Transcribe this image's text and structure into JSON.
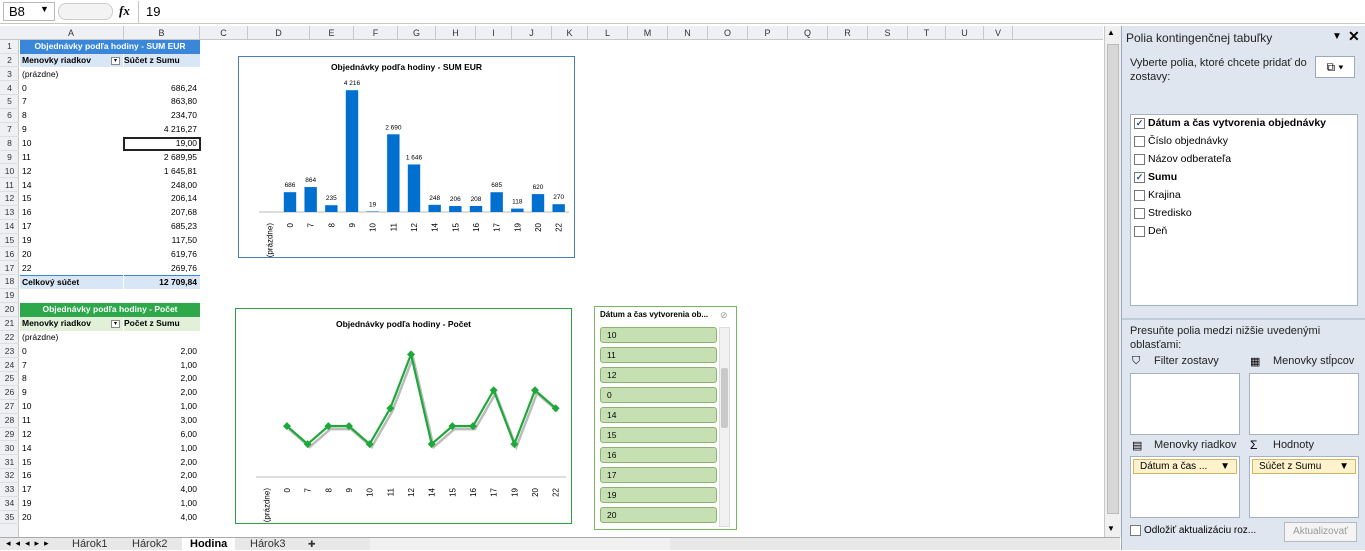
{
  "formula_bar": {
    "name_box": "B8",
    "fx": "fx",
    "value": "19"
  },
  "columns": [
    "A",
    "B",
    "C",
    "D",
    "E",
    "F",
    "G",
    "H",
    "I",
    "J",
    "K",
    "L",
    "M",
    "N",
    "O",
    "P",
    "Q",
    "R",
    "S",
    "T",
    "U",
    "V"
  ],
  "rows": [
    "1",
    "2",
    "3",
    "4",
    "5",
    "6",
    "7",
    "8",
    "9",
    "10",
    "11",
    "12",
    "13",
    "14",
    "15",
    "16",
    "17",
    "18",
    "19",
    "20",
    "21",
    "22",
    "23",
    "24",
    "25",
    "26",
    "27",
    "28",
    "29",
    "30",
    "31",
    "32",
    "33",
    "34",
    "35"
  ],
  "pivot1": {
    "title": "Objednávky podľa hodiny - SUM EUR",
    "col_a": "Menovky riadkov",
    "col_b": "Súčet z Sumu",
    "rows": [
      [
        "(prázdne)",
        ""
      ],
      [
        "0",
        "686,24"
      ],
      [
        "7",
        "863,80"
      ],
      [
        "8",
        "234,70"
      ],
      [
        "9",
        "4 216,27"
      ],
      [
        "10",
        "19,00"
      ],
      [
        "11",
        "2 689,95"
      ],
      [
        "12",
        "1 645,81"
      ],
      [
        "14",
        "248,00"
      ],
      [
        "15",
        "206,14"
      ],
      [
        "16",
        "207,68"
      ],
      [
        "17",
        "685,23"
      ],
      [
        "19",
        "117,50"
      ],
      [
        "20",
        "619,76"
      ],
      [
        "22",
        "269,76"
      ]
    ],
    "total_label": "Celkový súčet",
    "total_value": "12 709,84"
  },
  "pivot2": {
    "title": "Objednávky podľa hodiny - Počet",
    "col_a": "Menovky riadkov",
    "col_b": "Počet z Sumu",
    "rows": [
      [
        "(prázdne)",
        ""
      ],
      [
        "0",
        "2,00"
      ],
      [
        "7",
        "1,00"
      ],
      [
        "8",
        "2,00"
      ],
      [
        "9",
        "2,00"
      ],
      [
        "10",
        "1,00"
      ],
      [
        "11",
        "3,00"
      ],
      [
        "12",
        "6,00"
      ],
      [
        "14",
        "1,00"
      ],
      [
        "15",
        "2,00"
      ],
      [
        "16",
        "2,00"
      ],
      [
        "17",
        "4,00"
      ],
      [
        "19",
        "1,00"
      ],
      [
        "20",
        "4,00"
      ]
    ]
  },
  "chart_data": [
    {
      "type": "bar",
      "title": "Objednávky podľa hodiny - SUM EUR",
      "categories": [
        "(prázdne)",
        "0",
        "7",
        "8",
        "9",
        "10",
        "11",
        "12",
        "14",
        "15",
        "16",
        "17",
        "19",
        "20",
        "22"
      ],
      "values": [
        0,
        686,
        864,
        235,
        4216,
        19,
        2690,
        1646,
        248,
        206,
        208,
        685,
        118,
        620,
        270
      ],
      "data_labels": [
        "",
        "686",
        "864",
        "235",
        "4 216",
        "19",
        "2 690",
        "1 646",
        "248",
        "206",
        "208",
        "685",
        "118",
        "620",
        "270"
      ],
      "color": "#0070d0"
    },
    {
      "type": "line",
      "title": "Objednávky podľa hodiny - Počet",
      "categories": [
        "(prázdne)",
        "0",
        "7",
        "8",
        "9",
        "10",
        "11",
        "12",
        "14",
        "15",
        "16",
        "17",
        "19",
        "20",
        "22"
      ],
      "values": [
        null,
        2,
        1,
        2,
        2,
        1,
        3,
        6,
        1,
        2,
        2,
        4,
        1,
        4,
        3
      ],
      "color": "#1fa83a"
    }
  ],
  "slicer": {
    "title": "Dátum a čas vytvorenia ob...",
    "items": [
      "10",
      "11",
      "12",
      "0",
      "14",
      "15",
      "16",
      "17",
      "19",
      "20"
    ]
  },
  "sheet_tabs": [
    "Hárok1",
    "Hárok2",
    "Hodina",
    "Hárok3"
  ],
  "active_tab": "Hodina",
  "panel": {
    "title": "Polia kontingenčnej tabuľky",
    "choose_text": "Vyberte polia, ktoré chcete pridať do zostavy:",
    "fields": [
      {
        "label": "Dátum a čas vytvorenia objednávky",
        "checked": true
      },
      {
        "label": "Číslo objednávky",
        "checked": false
      },
      {
        "label": "Názov odberateľa",
        "checked": false
      },
      {
        "label": "Sumu",
        "checked": true
      },
      {
        "label": "Krajina",
        "checked": false
      },
      {
        "label": "Stredisko",
        "checked": false
      },
      {
        "label": "Deň",
        "checked": false
      }
    ],
    "drag_text": "Presuňte polia medzi nižšie uvedenými oblasťami:",
    "filter_label": "Filter zostavy",
    "columns_label": "Menovky stĺpcov",
    "rows_label": "Menovky riadkov",
    "values_label": "Hodnoty",
    "rows_value": "Dátum a čas ...",
    "values_value": "Súčet z Sumu",
    "defer_label": "Odložiť aktualizáciu roz...",
    "update_label": "Aktualizovať"
  }
}
